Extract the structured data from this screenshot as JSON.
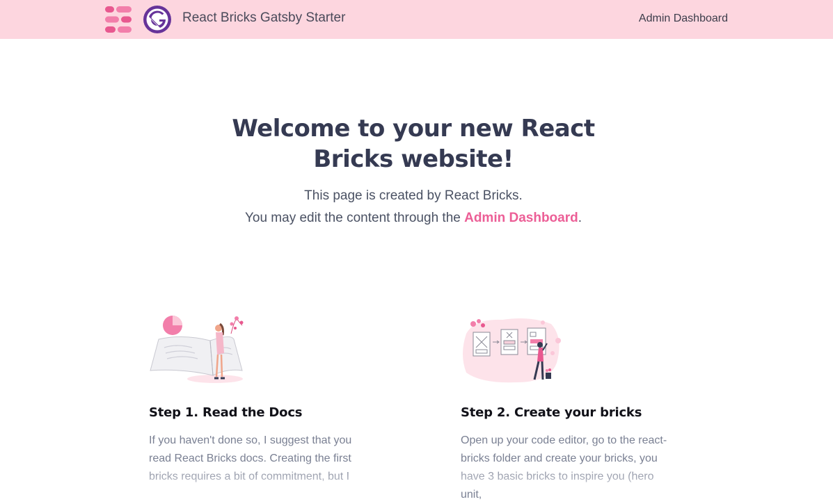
{
  "header": {
    "site_title": "React Bricks Gatsby Starter",
    "nav_admin_label": "Admin Dashboard",
    "logo_icons": [
      "react-bricks-logo-icon",
      "gatsby-logo-icon"
    ]
  },
  "hero": {
    "title": "Welcome to your new React Bricks website!",
    "line1": "This page is created by React Bricks.",
    "line2_prefix": "You may edit the content through the ",
    "line2_link": "Admin Dashboard",
    "line2_suffix": "."
  },
  "steps": [
    {
      "title": "Step 1. Read the Docs",
      "text": "If you haven't done so, I suggest that you read React Bricks docs. Creating the first bricks requires a bit of commitment, but I",
      "illustration": "reading-book-illustration"
    },
    {
      "title": "Step 2. Create your bricks",
      "text": "Open up your code editor, go to the react-bricks folder and create your bricks, you have 3 basic bricks to inspire you (hero unit,",
      "illustration": "wireframe-board-illustration"
    }
  ],
  "colors": {
    "header_bg": "#fdd6df",
    "brand_pink": "#ec5e96",
    "gatsby_purple": "#663399",
    "heading": "#353a52",
    "body_text": "#7a8093"
  }
}
